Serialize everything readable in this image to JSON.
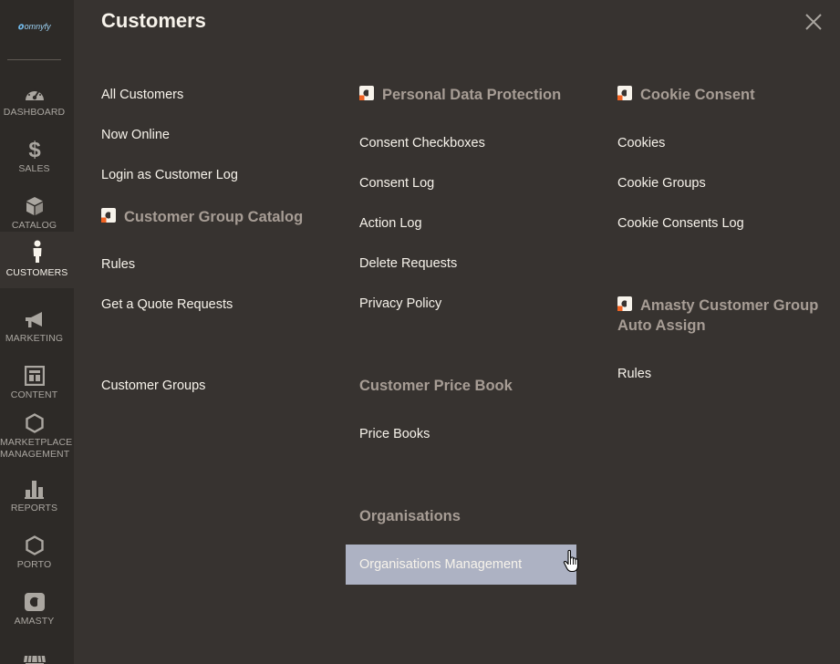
{
  "sidebar": {
    "logo_text": "omnyfy",
    "items": [
      {
        "label": "DASHBOARD",
        "icon": "dashboard-gauge-icon"
      },
      {
        "label": "SALES",
        "icon": "dollar-icon"
      },
      {
        "label": "CATALOG",
        "icon": "box-icon"
      },
      {
        "label": "CUSTOMERS",
        "icon": "person-icon",
        "active": true
      },
      {
        "label": "MARKETING",
        "icon": "megaphone-icon"
      },
      {
        "label": "CONTENT",
        "icon": "layout-icon"
      },
      {
        "label_line1": "MARKETPLACE",
        "label_line2": "MANAGEMENT",
        "icon": "hexagon-icon"
      },
      {
        "label": "REPORTS",
        "icon": "bar-chart-icon"
      },
      {
        "label": "PORTO",
        "icon": "hexagon-icon"
      },
      {
        "label": "AMASTY",
        "icon": "amasty-icon"
      },
      {
        "label": "",
        "icon": "store-icon"
      }
    ]
  },
  "panel": {
    "title": "Customers",
    "close_icon": "close-icon",
    "column1": {
      "links_top": [
        "All Customers",
        "Now Online",
        "Login as Customer Log"
      ],
      "group_customer_group_catalog": {
        "title": "Customer Group Catalog",
        "links": [
          "Rules",
          "Get a Quote Requests"
        ]
      },
      "link_customer_groups": "Customer Groups"
    },
    "column2": {
      "group_personal_data_protection": {
        "title": "Personal Data Protection",
        "links": [
          "Consent Checkboxes",
          "Consent Log",
          "Action Log",
          "Delete Requests",
          "Privacy Policy"
        ]
      },
      "group_customer_price_book": {
        "title": "Customer Price Book",
        "links": [
          "Price Books"
        ]
      },
      "group_organisations": {
        "title": "Organisations",
        "links": [
          "Organisations Management"
        ]
      }
    },
    "column3": {
      "group_cookie_consent": {
        "title": "Cookie Consent",
        "links": [
          "Cookies",
          "Cookie Groups",
          "Cookie Consents Log"
        ]
      },
      "group_amasty_auto_assign": {
        "title_line1": "Amasty Customer Group",
        "title_line2": "Auto Assign",
        "links": [
          "Rules"
        ]
      }
    }
  },
  "colors": {
    "sidebar_bg": "#2d2a27",
    "panel_bg": "#373330",
    "link_text": "#f7f3eb",
    "group_title": "#a79d95",
    "hover_bg": "#adb2c3",
    "amasty_accent": "#f26322"
  }
}
